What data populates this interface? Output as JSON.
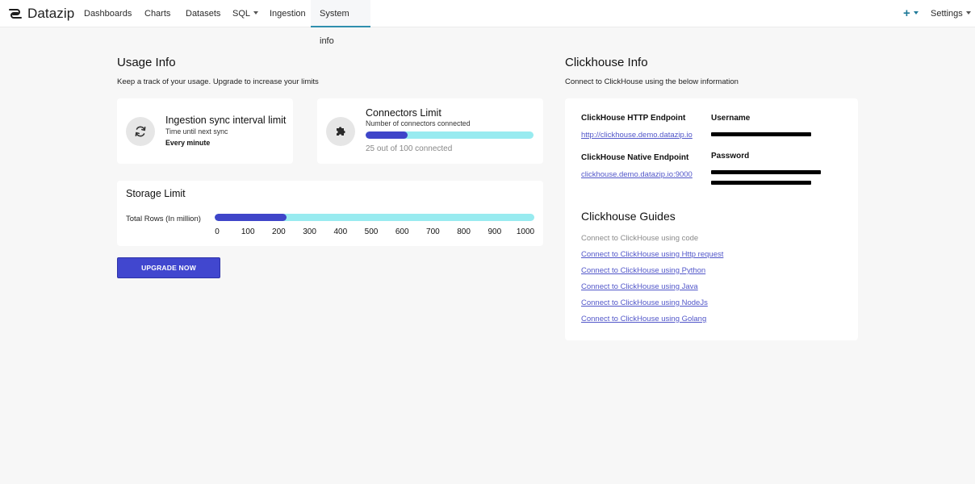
{
  "nav": {
    "brand": "Datazip",
    "items": [
      {
        "label": "Dashboards"
      },
      {
        "label": "Charts"
      },
      {
        "label": "Datasets"
      },
      {
        "label": "SQL"
      },
      {
        "label": "Ingestion"
      },
      {
        "label": "System info"
      }
    ],
    "plus_label": "+",
    "settings_label": "Settings"
  },
  "usage": {
    "title": "Usage Info",
    "subtitle": "Keep a track of your usage. Upgrade to increase your limits",
    "sync_card": {
      "title": "Ingestion sync interval limit",
      "subtitle": "Time until next sync",
      "value": "Every minute",
      "icon": "sync-icon"
    },
    "connectors_card": {
      "title": "Connectors Limit",
      "subtitle": "Number of connectors connected",
      "status": "25 out of 100 connected",
      "progress_fraction": 0.25,
      "icon": "puzzle-icon"
    },
    "storage": {
      "title": "Storage Limit",
      "label": "Total Rows (In million)",
      "ticks": [
        "0",
        "100",
        "200",
        "300",
        "400",
        "500",
        "600",
        "700",
        "800",
        "900",
        "1000"
      ],
      "used_value": 225,
      "max_value": 1000
    },
    "upgrade_label": "UPGRADE NOW"
  },
  "clickhouse": {
    "title": "Clickhouse Info",
    "subtitle": "Connect to ClickHouse using the below information",
    "http_label": "ClickHouse HTTP Endpoint",
    "http_value": "http://clickhouse.demo.datazip.io",
    "native_label": "ClickHouse Native Endpoint",
    "native_value": "clickhouse.demo.datazip.io:9000",
    "username_label": "Username",
    "password_label": "Password",
    "guides_title": "Clickhouse Guides",
    "guides_intro": "Connect to ClickHouse using code",
    "guides": [
      {
        "label": "Connect to ClickHouse using Http request"
      },
      {
        "label": "Connect to ClickHouse using Python"
      },
      {
        "label": "Connect to ClickHouse using Java"
      },
      {
        "label": "Connect to ClickHouse using NodeJs"
      },
      {
        "label": "Connect to ClickHouse using Golang"
      }
    ]
  },
  "colors": {
    "accent": "#2f8fae",
    "primary": "#4147cf",
    "progress_track": "#98ebf0",
    "progress_fill": "#3f45c9",
    "link": "#5156c9"
  }
}
